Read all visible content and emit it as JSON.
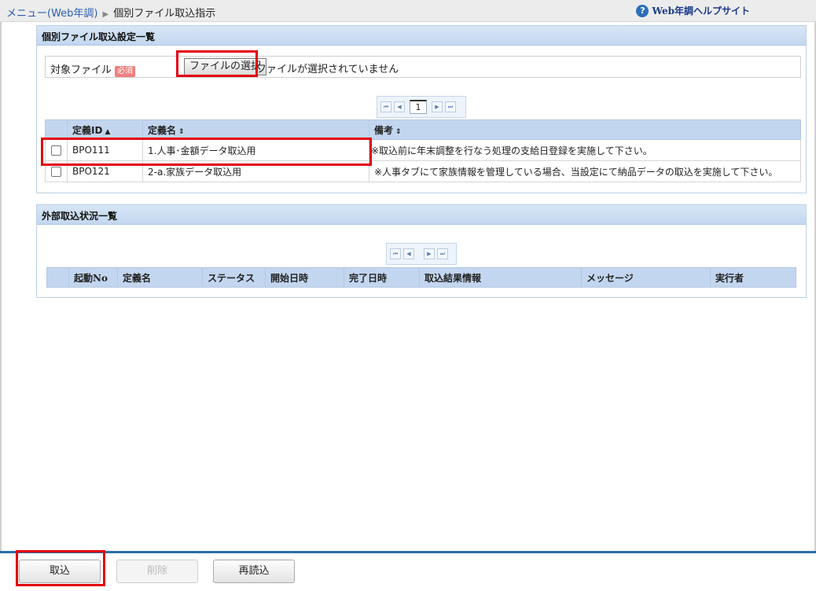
{
  "breadcrumb": {
    "menu": "メニュー(Web年調)",
    "current": "個別ファイル取込指示"
  },
  "help": {
    "label": "Web年調ヘルプサイト",
    "icon": "question-icon"
  },
  "settings_panel": {
    "title": "個別ファイル取込設定一覧",
    "file_label": "対象ファイル",
    "required_badge": "必須",
    "choose_button": "ファイルの選択",
    "file_status": "ファイルが選択されていません",
    "pager": {
      "first": "⏮",
      "prev": "◀",
      "page": "1",
      "next": "▶",
      "last": "⏭"
    },
    "columns": {
      "id": "定義ID",
      "name": "定義名",
      "note": "備考"
    },
    "rows": [
      {
        "id": "BPO111",
        "name": "1.人事･金額データ取込用",
        "note": "※取込前に年末調整を行なう処理の支給日登録を実施して下さい。"
      },
      {
        "id": "BPO121",
        "name": "2-a.家族データ取込用",
        "note": "※人事タブにて家族情報を管理している場合、当設定にて納品データの取込を実施して下さい。"
      }
    ]
  },
  "status_panel": {
    "title": "外部取込状況一覧",
    "columns": [
      "起動No",
      "定義名",
      "ステータス",
      "開始日時",
      "完了日時",
      "取込結果情報",
      "メッセージ",
      "実行者"
    ]
  },
  "buttons": {
    "import": "取込",
    "delete": "削除",
    "reload": "再読込"
  }
}
